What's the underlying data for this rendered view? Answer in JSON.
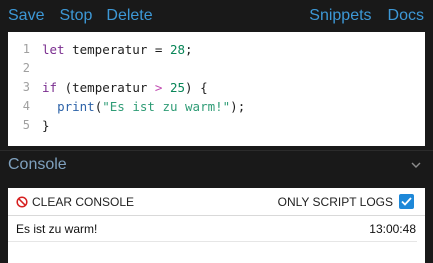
{
  "toolbar": {
    "save": "Save",
    "stop": "Stop",
    "delete": "Delete",
    "snippets": "Snippets",
    "docs": "Docs",
    "link_color": "#3d98d6"
  },
  "editor": {
    "lines": [
      {
        "num": "1",
        "tokens": [
          {
            "t": "let",
            "c": "kw"
          },
          {
            "t": " temperatur ",
            "c": "code"
          },
          {
            "t": "=",
            "c": "code"
          },
          {
            "t": " ",
            "c": "code"
          },
          {
            "t": "28",
            "c": "num"
          },
          {
            "t": ";",
            "c": "code"
          }
        ]
      },
      {
        "num": "2",
        "tokens": []
      },
      {
        "num": "3",
        "tokens": [
          {
            "t": "if",
            "c": "kw"
          },
          {
            "t": " (temperatur ",
            "c": "code"
          },
          {
            "t": ">",
            "c": "op"
          },
          {
            "t": " ",
            "c": "code"
          },
          {
            "t": "25",
            "c": "num"
          },
          {
            "t": ") {",
            "c": "code"
          }
        ]
      },
      {
        "num": "4",
        "tokens": [
          {
            "t": "  ",
            "c": "code"
          },
          {
            "t": "print",
            "c": "fn"
          },
          {
            "t": "(",
            "c": "code"
          },
          {
            "t": "\"Es ist zu warm!\"",
            "c": "str"
          },
          {
            "t": ");",
            "c": "code"
          }
        ]
      },
      {
        "num": "5",
        "tokens": [
          {
            "t": "}",
            "c": "code"
          }
        ]
      }
    ]
  },
  "console": {
    "title": "Console",
    "clear_label": "CLEAR CONSOLE",
    "only_script_logs_label": "ONLY SCRIPT LOGS",
    "only_script_logs_checked": true,
    "logs": [
      {
        "message": "Es ist zu warm!",
        "time": "13:00:48"
      }
    ]
  }
}
